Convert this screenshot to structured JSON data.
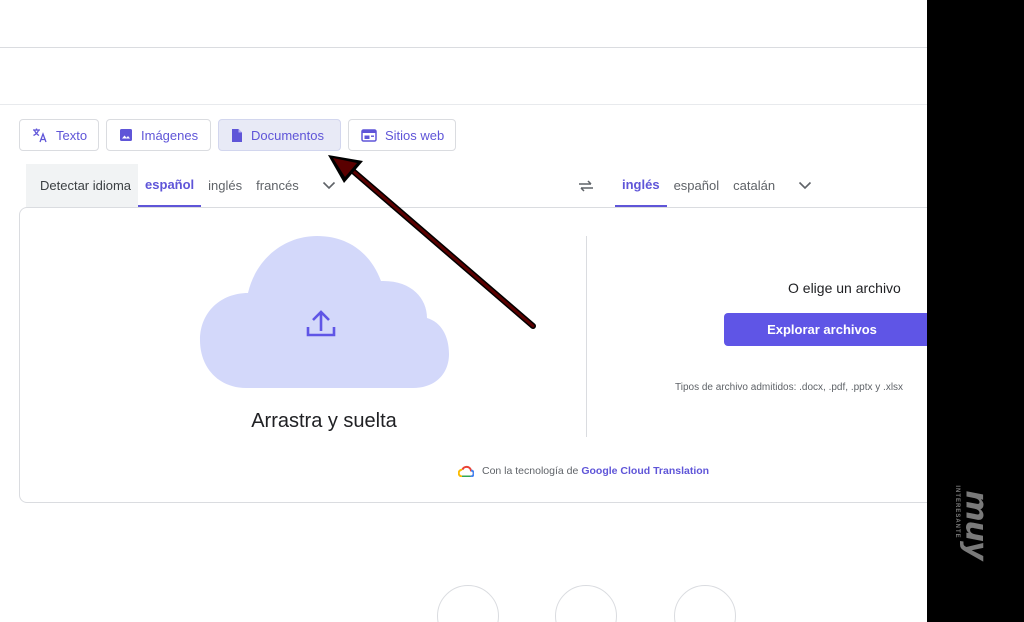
{
  "tabs": {
    "text": "Texto",
    "images": "Imágenes",
    "documents": "Documentos",
    "websites": "Sitios web"
  },
  "source_langs": {
    "detect": "Detectar idioma",
    "items": [
      "español",
      "inglés",
      "francés"
    ],
    "selected": "español"
  },
  "target_langs": {
    "items": [
      "inglés",
      "español",
      "catalán"
    ],
    "selected": "inglés"
  },
  "upload": {
    "drop_text": "Arrastra y suelta",
    "choose_text": "O elige un archivo",
    "browse_label": "Explorar archivos",
    "file_types": "Tipos de archivo admitidos: .docx, .pdf, .pptx y .xlsx"
  },
  "footer": {
    "powered_prefix": "Con la tecnología de",
    "powered_link": "Google Cloud Translation"
  },
  "watermark": {
    "brand": "muy",
    "sub": "INTERESANTE"
  },
  "colors": {
    "accent": "#5f55e6",
    "tab_active_bg": "#e8eaf6",
    "cloud": "#d3d8fa",
    "annotation_arrow": "#5a0000"
  },
  "icons": {
    "text_tab": "translate-icon",
    "images_tab": "image-icon",
    "documents_tab": "document-icon",
    "websites_tab": "web-icon",
    "swap": "swap-icon",
    "upload": "upload-icon",
    "dropdown": "chevron-down-icon",
    "google_cloud": "google-cloud-icon"
  }
}
